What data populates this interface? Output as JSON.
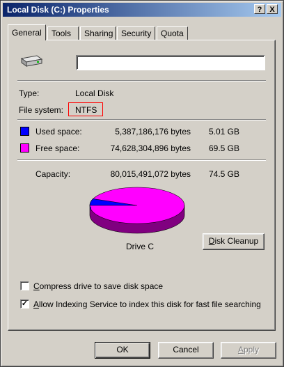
{
  "window": {
    "title": "Local Disk (C:) Properties",
    "help_btn": "?",
    "close_btn": "X"
  },
  "tabs": [
    {
      "label": "General",
      "active": true
    },
    {
      "label": "Tools"
    },
    {
      "label": "Sharing"
    },
    {
      "label": "Security"
    },
    {
      "label": "Quota"
    }
  ],
  "general": {
    "volume_name_value": "",
    "type_label": "Type:",
    "type_value": "Local Disk",
    "fs_label": "File system:",
    "fs_value": "NTFS",
    "used": {
      "label": "Used space:",
      "bytes": "5,387,186,176 bytes",
      "size": "5.01 GB",
      "color": "#0000ff"
    },
    "free": {
      "label": "Free space:",
      "bytes": "74,628,304,896 bytes",
      "size": "69.5 GB",
      "color": "#ff00ff"
    },
    "capacity": {
      "label": "Capacity:",
      "bytes": "80,015,491,072 bytes",
      "size": "74.5 GB"
    },
    "drive_label": "Drive C",
    "cleanup_button": {
      "accel": "D",
      "rest": "isk Cleanup"
    },
    "compress": {
      "accel": "C",
      "rest": "ompress drive to save disk space",
      "checked": false
    },
    "indexing": {
      "accel": "A",
      "rest": "llow Indexing Service to index this disk for fast file searching",
      "checked": true
    }
  },
  "buttons": {
    "ok": "OK",
    "cancel": "Cancel",
    "apply": {
      "accel": "A",
      "rest": "pply",
      "enabled": false
    }
  },
  "colors": {
    "titlebar_start": "#0a246a",
    "highlight_box": "#ff0000",
    "pie_used": "#0000ff",
    "pie_free": "#ff00ff"
  },
  "icons": {
    "drive": "hard-drive-icon"
  }
}
